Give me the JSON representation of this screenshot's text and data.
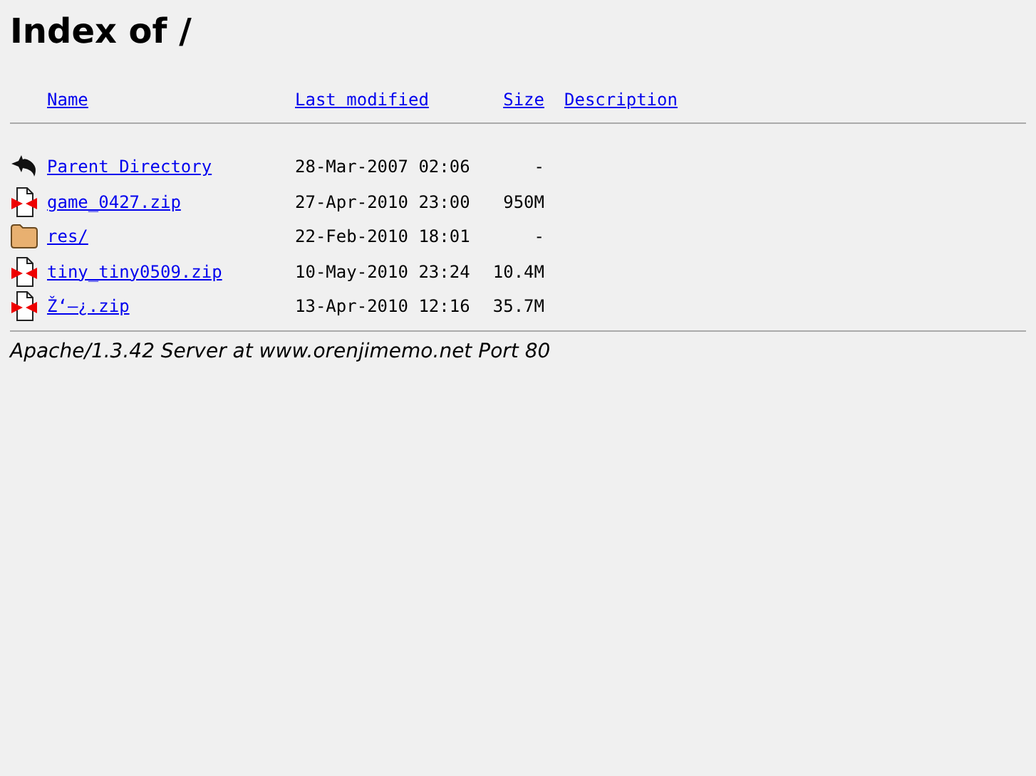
{
  "title": "Index of /",
  "columns": [
    "Name",
    "Last modified",
    "Size",
    "Description"
  ],
  "rows": [
    {
      "kind": "back",
      "name": "Parent Directory",
      "modified": "28-Mar-2007 02:06",
      "size": "-"
    },
    {
      "kind": "archive",
      "name": "game_0427.zip",
      "modified": "27-Apr-2010 23:00",
      "size": "950M"
    },
    {
      "kind": "folder",
      "name": "res/",
      "modified": "22-Feb-2010 18:01",
      "size": "-"
    },
    {
      "kind": "archive",
      "name": "tiny_tiny0509.zip",
      "modified": "10-May-2010 23:24",
      "size": "10.4M"
    },
    {
      "kind": "archive",
      "name": "Ž‘–¿.zip",
      "modified": "13-Apr-2010 12:16",
      "size": "35.7M"
    }
  ],
  "footer": "Apache/1.3.42 Server at www.orenjimemo.net Port 80"
}
